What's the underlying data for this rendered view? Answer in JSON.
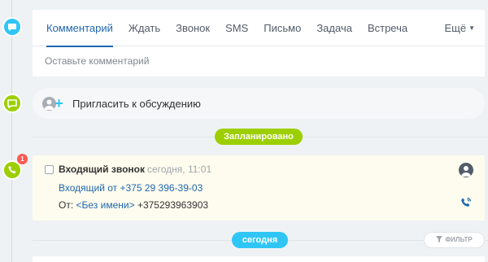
{
  "editor": {
    "tabs": [
      {
        "label": "Комментарий",
        "active": true
      },
      {
        "label": "Ждать"
      },
      {
        "label": "Звонок"
      },
      {
        "label": "SMS"
      },
      {
        "label": "Письмо"
      },
      {
        "label": "Задача"
      },
      {
        "label": "Встреча"
      }
    ],
    "more_label": "Ещё",
    "comment_placeholder": "Оставьте комментарий"
  },
  "invite": {
    "label": "Пригласить к обсуждению"
  },
  "sections": {
    "planned_label": "Запланировано",
    "today_label": "сегодня"
  },
  "activity": {
    "badge_count": "1",
    "title": "Входящий звонок",
    "time": "сегодня, 11:01",
    "subtitle": "Входящий от +375 29 396-39-03",
    "from_prefix": "От:",
    "from_name": "<Без имени>",
    "from_phone": "+375293963903"
  },
  "filter_label": "ФИЛЬТР",
  "colors": {
    "accent_blue": "#2fc6f6",
    "accent_green": "#9dcf00",
    "link": "#2067b0",
    "badge_red": "#ff5752"
  }
}
